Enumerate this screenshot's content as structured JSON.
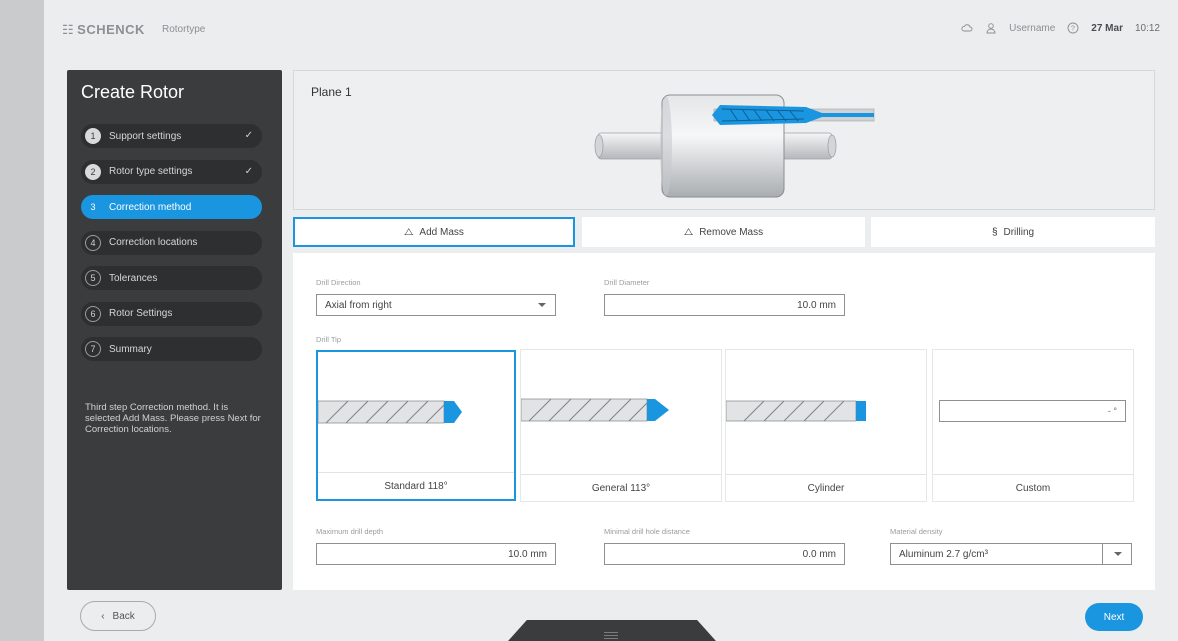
{
  "header": {
    "logo_text": "SCHENCK",
    "app_title": "Rotortype",
    "username": "Username",
    "date": "27 Mar",
    "time": "10:12"
  },
  "sidebar": {
    "title": "Create Rotor",
    "steps": [
      {
        "num": "1",
        "label": "Support settings",
        "state": "done"
      },
      {
        "num": "2",
        "label": "Rotor type settings",
        "state": "done"
      },
      {
        "num": "3",
        "label": "Correction method",
        "state": "active"
      },
      {
        "num": "4",
        "label": "Correction locations",
        "state": "pending"
      },
      {
        "num": "5",
        "label": "Tolerances",
        "state": "pending"
      },
      {
        "num": "6",
        "label": "Rotor Settings",
        "state": "pending"
      },
      {
        "num": "7",
        "label": "Summary",
        "state": "pending"
      }
    ],
    "help_text": "Third step Correction method. It is selected Add Mass. Please press Next for Correction locations."
  },
  "plane": {
    "title": "Plane 1"
  },
  "tabs": [
    {
      "icon": "add-mass-icon",
      "label": "Add Mass",
      "selected": true
    },
    {
      "icon": "remove-mass-icon",
      "label": "Remove Mass",
      "selected": false
    },
    {
      "icon": "drilling-icon",
      "label": "Drilling",
      "selected": false
    }
  ],
  "form": {
    "drill_direction": {
      "label": "Drill Direction",
      "value": "Axial from right"
    },
    "drill_diameter": {
      "label": "Drill Diameter",
      "value": "10.0 mm"
    },
    "drill_tip": {
      "label": "Drill Tip",
      "options": [
        {
          "label": "Standard 118°",
          "selected": true
        },
        {
          "label": "General 113°",
          "selected": false
        },
        {
          "label": "Cylinder",
          "selected": false
        },
        {
          "label": "Custom",
          "selected": false,
          "value": "- °"
        }
      ]
    },
    "max_drill_depth": {
      "label": "Maximum drill depth",
      "value": "10.0 mm"
    },
    "min_hole_distance": {
      "label": "Minimal drill hole distance",
      "value": "0.0 mm"
    },
    "material_density": {
      "label": "Material density",
      "value": "Aluminum 2.7 g/cm³"
    }
  },
  "footer": {
    "back_label": "Back",
    "next_label": "Next"
  },
  "colors": {
    "accent": "#1a95e0",
    "sidebar_bg": "#3a3c3e"
  }
}
